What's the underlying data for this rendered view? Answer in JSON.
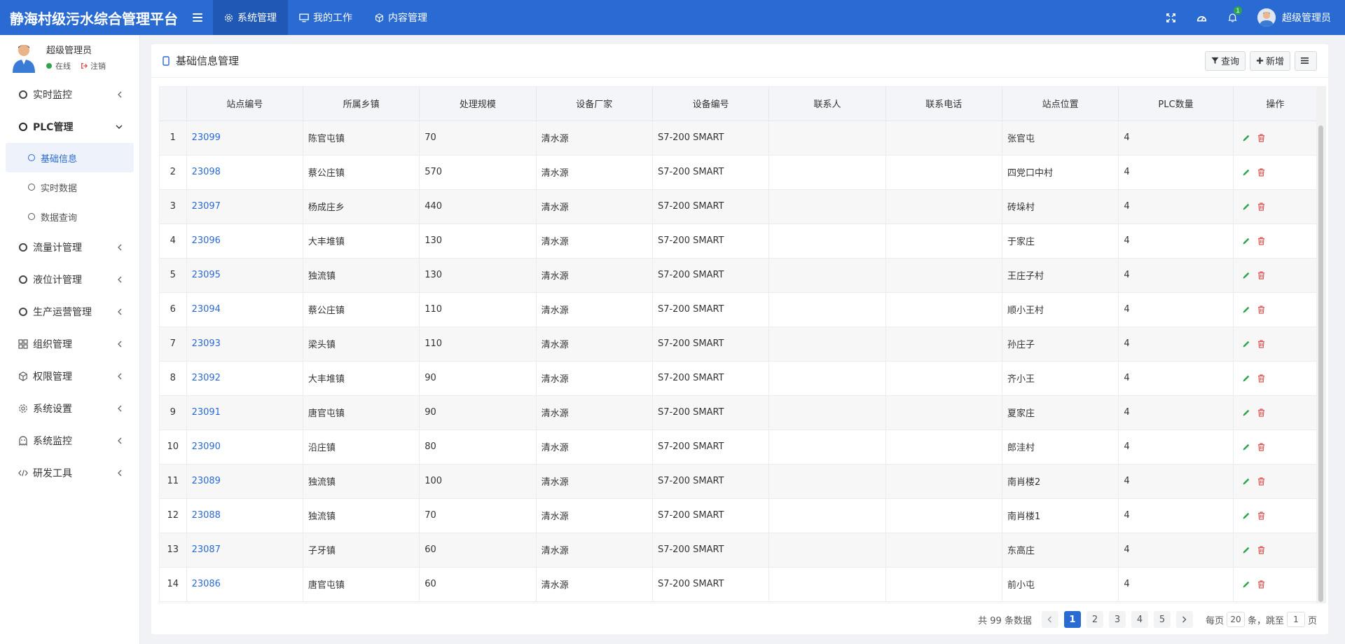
{
  "app": {
    "title": "静海村级污水综合管理平台",
    "accent_color": "#2a6ad3"
  },
  "topnav": {
    "items": [
      {
        "label": "系统管理",
        "icon": "gear-icon",
        "active": true
      },
      {
        "label": "我的工作",
        "icon": "monitor-icon",
        "active": false
      },
      {
        "label": "内容管理",
        "icon": "cube-icon",
        "active": false
      }
    ],
    "notification_count": "1",
    "username": "超级管理员"
  },
  "sidebar": {
    "user": {
      "name": "超级管理员",
      "status": "在线",
      "logout": "注销"
    },
    "menu": [
      {
        "label": "实时监控",
        "icon": "circle-icon",
        "open": false
      },
      {
        "label": "PLC管理",
        "icon": "circle-icon",
        "open": true,
        "children": [
          {
            "label": "基础信息",
            "active": true
          },
          {
            "label": "实时数据",
            "active": false
          },
          {
            "label": "数据查询",
            "active": false
          }
        ]
      },
      {
        "label": "流量计管理",
        "icon": "circle-icon",
        "open": false
      },
      {
        "label": "液位计管理",
        "icon": "circle-icon",
        "open": false
      },
      {
        "label": "生产运营管理",
        "icon": "circle-icon",
        "open": false
      },
      {
        "label": "组织管理",
        "icon": "grid-icon",
        "open": false
      },
      {
        "label": "权限管理",
        "icon": "cube-icon",
        "open": false
      },
      {
        "label": "系统设置",
        "icon": "gear-icon",
        "open": false
      },
      {
        "label": "系统监控",
        "icon": "ghost-icon",
        "open": false
      },
      {
        "label": "研发工具",
        "icon": "code-icon",
        "open": false
      }
    ]
  },
  "panel": {
    "title": "基础信息管理",
    "query_label": "查询",
    "add_label": "新增"
  },
  "table": {
    "columns": [
      "",
      "站点编号",
      "所属乡镇",
      "处理规模",
      "设备厂家",
      "设备编号",
      "联系人",
      "联系电话",
      "站点位置",
      "PLC数量",
      "操作"
    ],
    "rows": [
      [
        "1",
        "23099",
        "陈官屯镇",
        "70",
        "清水源",
        "S7-200 SMART",
        "",
        "",
        "张官屯",
        "4"
      ],
      [
        "2",
        "23098",
        "蔡公庄镇",
        "570",
        "清水源",
        "S7-200 SMART",
        "",
        "",
        "四党口中村",
        "4"
      ],
      [
        "3",
        "23097",
        "杨成庄乡",
        "440",
        "清水源",
        "S7-200 SMART",
        "",
        "",
        "砖垛村",
        "4"
      ],
      [
        "4",
        "23096",
        "大丰堆镇",
        "130",
        "清水源",
        "S7-200 SMART",
        "",
        "",
        "于家庄",
        "4"
      ],
      [
        "5",
        "23095",
        "独流镇",
        "130",
        "清水源",
        "S7-200 SMART",
        "",
        "",
        "王庄子村",
        "4"
      ],
      [
        "6",
        "23094",
        "蔡公庄镇",
        "110",
        "清水源",
        "S7-200 SMART",
        "",
        "",
        "顺小王村",
        "4"
      ],
      [
        "7",
        "23093",
        "梁头镇",
        "110",
        "清水源",
        "S7-200 SMART",
        "",
        "",
        "孙庄子",
        "4"
      ],
      [
        "8",
        "23092",
        "大丰堆镇",
        "90",
        "清水源",
        "S7-200 SMART",
        "",
        "",
        "齐小王",
        "4"
      ],
      [
        "9",
        "23091",
        "唐官屯镇",
        "90",
        "清水源",
        "S7-200 SMART",
        "",
        "",
        "夏家庄",
        "4"
      ],
      [
        "10",
        "23090",
        "沿庄镇",
        "80",
        "清水源",
        "S7-200 SMART",
        "",
        "",
        "郎洼村",
        "4"
      ],
      [
        "11",
        "23089",
        "独流镇",
        "100",
        "清水源",
        "S7-200 SMART",
        "",
        "",
        "南肖楼2",
        "4"
      ],
      [
        "12",
        "23088",
        "独流镇",
        "70",
        "清水源",
        "S7-200 SMART",
        "",
        "",
        "南肖楼1",
        "4"
      ],
      [
        "13",
        "23087",
        "子牙镇",
        "60",
        "清水源",
        "S7-200 SMART",
        "",
        "",
        "东高庄",
        "4"
      ],
      [
        "14",
        "23086",
        "唐官屯镇",
        "60",
        "清水源",
        "S7-200 SMART",
        "",
        "",
        "前小屯",
        "4"
      ]
    ]
  },
  "pagination": {
    "total_text": "共 99 条数据",
    "pages": [
      "1",
      "2",
      "3",
      "4",
      "5"
    ],
    "current_page": "1",
    "per_page_label": "每页",
    "per_page_value": "20",
    "jump_label": "条，跳至",
    "jump_value": "1",
    "page_suffix": "页"
  }
}
